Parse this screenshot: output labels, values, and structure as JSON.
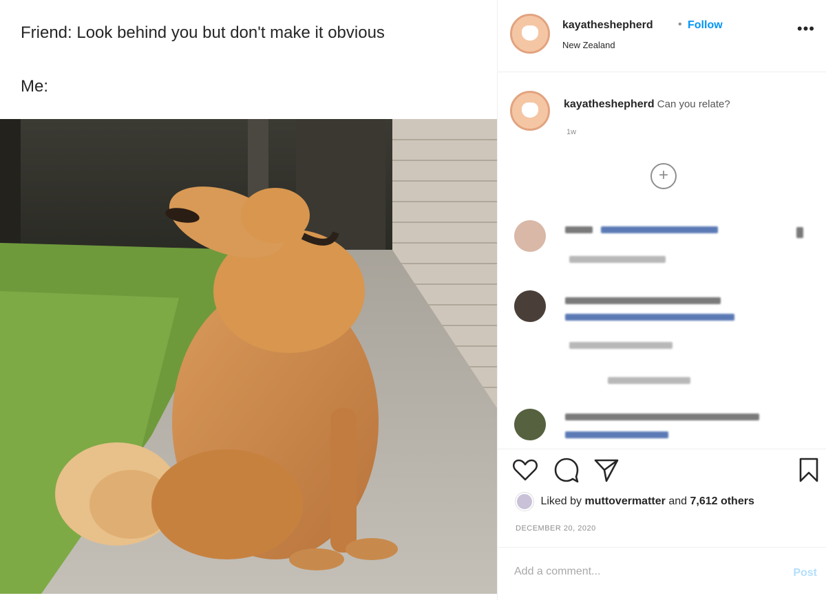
{
  "meme": {
    "line1": "Friend: Look behind you but don't make it obvious",
    "line2": "Me:"
  },
  "post_header": {
    "username": "kayatheshepherd",
    "separator": "•",
    "follow_label": "Follow",
    "location": "New Zealand",
    "more_label": "•••"
  },
  "caption": {
    "username": "kayatheshepherd",
    "text": "Can you relate?",
    "time": "1w"
  },
  "load_more": {
    "label": "+"
  },
  "likes": {
    "prefix": "Liked by",
    "liker": "muttovermatter",
    "middle": "and",
    "count_text": "7,612 others"
  },
  "date": "December 20, 2020",
  "comment_box": {
    "placeholder": "Add a comment...",
    "post_label": "Post"
  },
  "icons": {
    "like": "heart-icon",
    "comment": "comment-bubble-icon",
    "share": "paper-plane-icon",
    "save": "bookmark-icon",
    "more": "more-options-icon"
  },
  "colors": {
    "link_blue": "#0095f6",
    "post_disabled": "#b2dffc",
    "muted": "#8e8e8e",
    "text": "#262626"
  }
}
